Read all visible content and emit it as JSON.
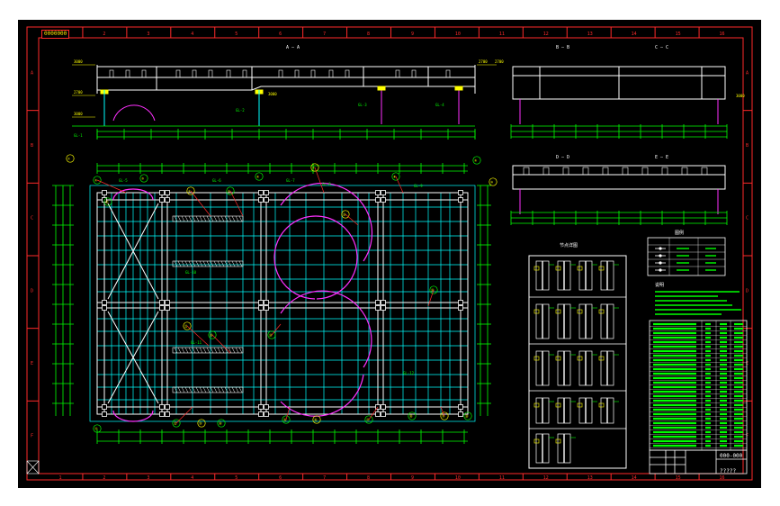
{
  "colors": {
    "frame": "#ff2a2a",
    "beam": "#ffffff",
    "grid": "#00ffff",
    "dim": "#00ff00",
    "arc": "#ff30ff",
    "note": "#ffff00",
    "table": "#00ff00"
  },
  "titlebar": {
    "stamp": "0000000",
    "drawing_code": "000-000",
    "drawing_name": "?????"
  },
  "border": {
    "columns": [
      "1",
      "2",
      "3",
      "4",
      "5",
      "6",
      "7",
      "8",
      "9",
      "10",
      "11",
      "12",
      "13",
      "14",
      "15",
      "16"
    ],
    "rows": [
      "A",
      "B",
      "C",
      "D",
      "E",
      "F"
    ]
  },
  "views": {
    "elev_main": "A — A",
    "elev_right_top_1": "B — B",
    "elev_right_top_2": "C — C",
    "elev_right_mid_1": "D — D",
    "elev_right_mid_2": "E — E",
    "details_title": "节点详图",
    "legend_title": "图例",
    "notes_title": "说明"
  },
  "elevation_tags": [
    "3000",
    "2700",
    "3000",
    "2700",
    "3000",
    "2700",
    "3000"
  ],
  "callouts": [
    "①",
    "②",
    "③",
    "④",
    "⑤",
    "⑥",
    "⑦",
    "⑧",
    "⑨",
    "⑩",
    "⑪",
    "⑫",
    "⑬",
    "⑭",
    "⑮",
    "⑯",
    "⑰",
    "⑱",
    "⑲",
    "⑳",
    "㉑",
    "㉒",
    "㉓",
    "㉔",
    "㉕",
    "㉖"
  ],
  "member_tags": [
    "GL-1",
    "GL-2",
    "GL-3",
    "GL-4",
    "GL-5",
    "GL-6",
    "GL-7",
    "GL-8",
    "GL-9",
    "GL-10",
    "GL-11",
    "GL-12"
  ]
}
